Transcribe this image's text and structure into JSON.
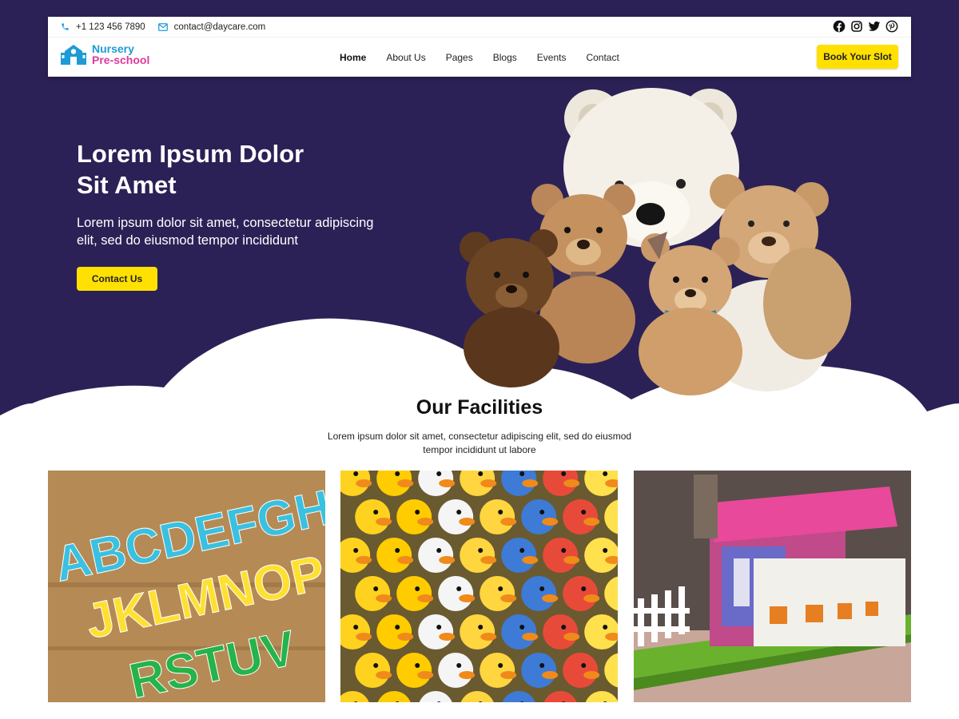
{
  "topbar": {
    "phone": "+1 123 456 7890",
    "email": "contact@daycare.com",
    "social_icons": [
      "facebook-icon",
      "instagram-icon",
      "twitter-icon",
      "pinterest-icon"
    ]
  },
  "logo": {
    "line1": "Nursery",
    "line2": "Pre-school"
  },
  "nav": {
    "items": [
      {
        "label": "Home",
        "active": true
      },
      {
        "label": "About Us",
        "active": false
      },
      {
        "label": "Pages",
        "active": false
      },
      {
        "label": "Blogs",
        "active": false
      },
      {
        "label": "Events",
        "active": false
      },
      {
        "label": "Contact",
        "active": false
      }
    ]
  },
  "header": {
    "book_label": "Book Your Slot"
  },
  "hero": {
    "title_line1": "Lorem Ipsum Dolor",
    "title_line2": "Sit Amet",
    "subtitle": "Lorem ipsum dolor sit amet, consectetur adipiscing elit, sed do eiusmod tempor incididunt",
    "button_label": "Contact Us"
  },
  "facilities": {
    "title": "Our Facilities",
    "subtitle": "Lorem ipsum dolor sit amet, consectetur adipiscing elit, sed do eiusmod tempor incididunt ut labore",
    "letters_row1": "ABCDEFGH",
    "letters_row2": "JKLMNOP",
    "letters_row3": "RSTUV"
  },
  "colors": {
    "hero_bg": "#2c2156",
    "accent_yellow": "#ffe000",
    "logo_blue": "#1e9ad6",
    "logo_pink": "#e0399b"
  }
}
